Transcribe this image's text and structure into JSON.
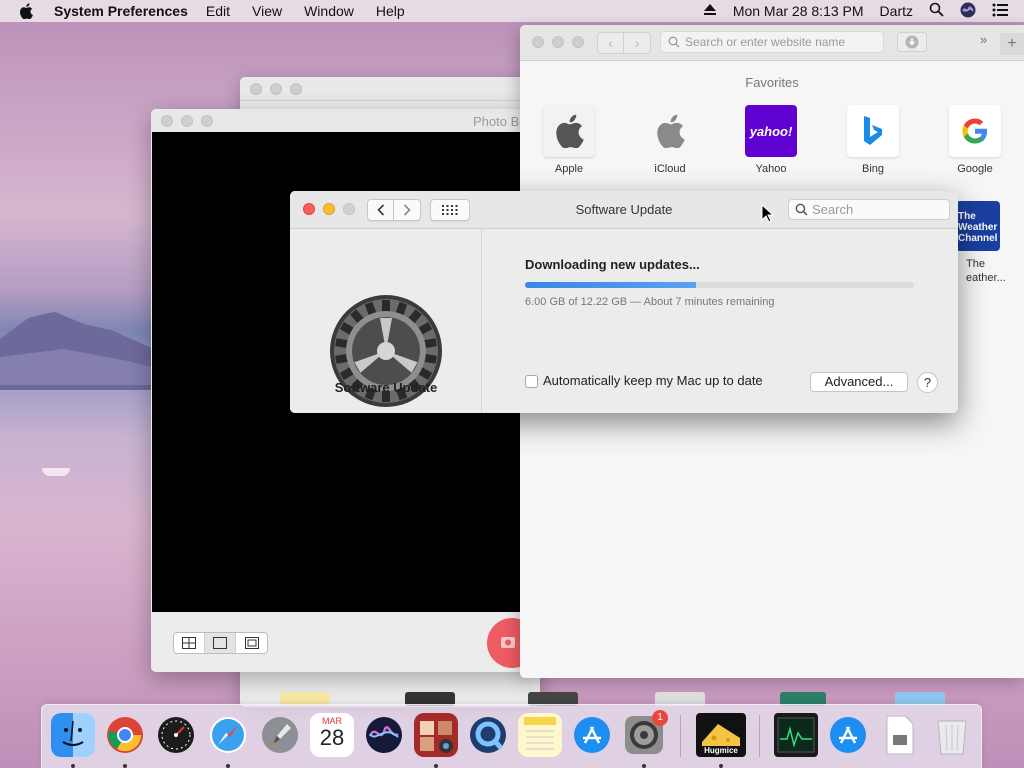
{
  "menubar": {
    "app_name": "System Preferences",
    "menus": [
      "Edit",
      "View",
      "Window",
      "Help"
    ],
    "clock": "Mon Mar 28  8:13 PM",
    "user": "Dartz",
    "icons": [
      "apple-icon",
      "eject-icon",
      "spotlight-icon",
      "siri-icon",
      "control-center-icon"
    ]
  },
  "photo_booth": {
    "title": "Photo B",
    "view_modes": [
      "grid-view-icon",
      "single-view-icon",
      "filmstrip-view-icon"
    ],
    "selected_view": 0
  },
  "safari": {
    "address_placeholder": "Search or enter website name",
    "favorites_heading": "Favorites",
    "favorites": [
      {
        "label": "Apple",
        "tile": "apple-icon"
      },
      {
        "label": "iCloud",
        "tile": "apple-icon"
      },
      {
        "label": "Yahoo",
        "tile_text": "yahoo!",
        "color": "#5f01d1"
      },
      {
        "label": "Bing",
        "tile": "bing-icon",
        "color": "#1a8be8"
      },
      {
        "label": "Google",
        "tile": "google-icon"
      },
      {
        "label": "The Weather Channel",
        "tile_text": "The Weather Channel",
        "color": "#1a3fa0",
        "visible_label_lines": [
          "The",
          "eather..."
        ]
      }
    ]
  },
  "software_update": {
    "window_title": "Software Update",
    "search_placeholder": "Search",
    "pane_label": "Software Update",
    "status_heading": "Downloading new updates...",
    "progress": 0.44,
    "progress_detail": "6.00 GB of 12.22 GB — About 7 minutes remaining",
    "auto_update_label": "Automatically keep my Mac up to date",
    "auto_update_checked": false,
    "advanced_button": "Advanced...",
    "help_button": "?"
  },
  "dock": {
    "apps": [
      {
        "name": "Finder",
        "icon": "finder-icon",
        "running": true
      },
      {
        "name": "Chrome",
        "icon": "chrome-icon",
        "running": true
      },
      {
        "name": "Activity Dashboard",
        "icon": "dashboard-icon",
        "running": false
      },
      {
        "name": "Safari",
        "icon": "safari-icon",
        "running": true
      },
      {
        "name": "Launchpad",
        "icon": "launchpad-icon",
        "running": false
      },
      {
        "name": "Calendar",
        "icon": "calendar-icon",
        "running": false,
        "month": "MAR",
        "day": "28"
      },
      {
        "name": "Siri",
        "icon": "siri-icon",
        "running": false
      },
      {
        "name": "Photo Booth",
        "icon": "photo-booth-icon",
        "running": true
      },
      {
        "name": "QuickTime",
        "icon": "quicktime-icon",
        "running": false
      },
      {
        "name": "Notes",
        "icon": "notes-icon",
        "running": false
      },
      {
        "name": "App Store",
        "icon": "app-store-icon",
        "running": false
      },
      {
        "name": "System Preferences",
        "icon": "system-preferences-icon",
        "running": true,
        "badge": "1"
      },
      {
        "name": "Hugmice",
        "icon": "hugmice-icon",
        "running": true,
        "label": "Hugmice"
      },
      {
        "name": "Activity Monitor",
        "icon": "activity-monitor-icon",
        "running": false
      },
      {
        "name": "App Store Download",
        "icon": "app-store-download-icon",
        "running": false
      },
      {
        "name": "Document",
        "icon": "document-icon",
        "running": false
      },
      {
        "name": "Trash",
        "icon": "trash-icon",
        "running": false
      }
    ]
  },
  "colors": {
    "accent_blue": "#3b86e6",
    "close_red": "#fc5f57",
    "minimize_yellow": "#fdbc2e",
    "zoom_gray": "#d0d0d0"
  }
}
